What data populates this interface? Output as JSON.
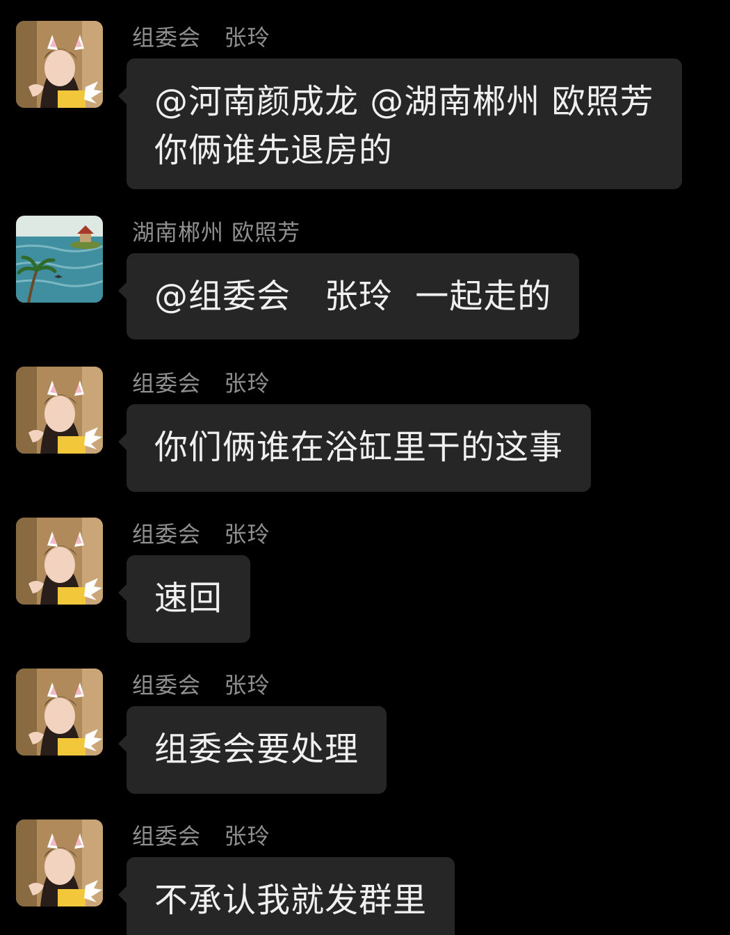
{
  "messages": [
    {
      "sender": "组委会   张玲",
      "avatar": "cat-ear-girl-avatar",
      "text": "@河南颜成龙 @湖南郴州 欧照芳\n你俩谁先退房的"
    },
    {
      "sender": "湖南郴州 欧照芳",
      "avatar": "island-landscape-avatar",
      "text": "@组委会   张玲  一起走的"
    },
    {
      "sender": "组委会   张玲",
      "avatar": "cat-ear-girl-avatar",
      "text": "你们俩谁在浴缸里干的这事"
    },
    {
      "sender": "组委会   张玲",
      "avatar": "cat-ear-girl-avatar",
      "text": "速回"
    },
    {
      "sender": "组委会   张玲",
      "avatar": "cat-ear-girl-avatar",
      "text": "组委会要处理"
    },
    {
      "sender": "组委会   张玲",
      "avatar": "cat-ear-girl-avatar",
      "text": "不承认我就发群里"
    }
  ],
  "colors": {
    "background": "#000000",
    "bubble": "#262626",
    "sender_text": "#8f8f8f",
    "message_text": "#f0f0f0"
  }
}
